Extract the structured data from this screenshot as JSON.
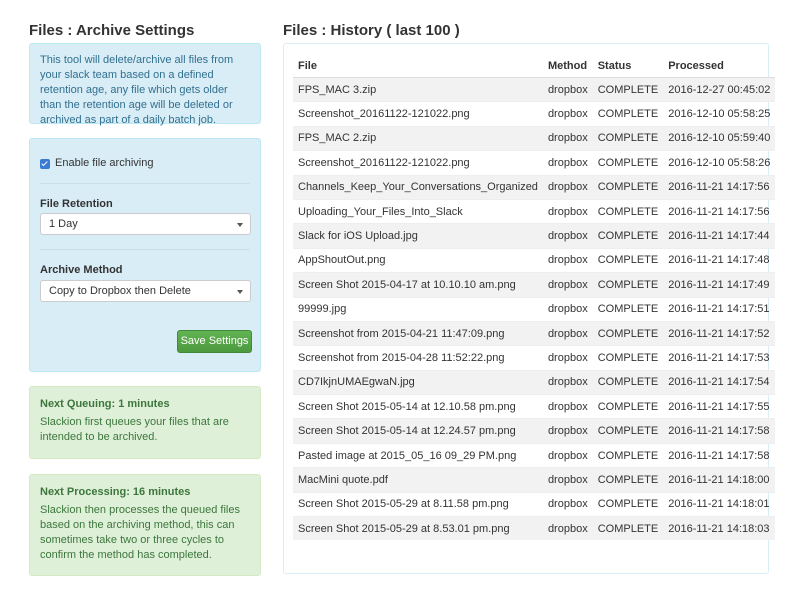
{
  "left_title": "Files : Archive Settings",
  "right_title": "Files : History ( last 100 )",
  "about_text": "This tool will delete/archive all files from your slack team based on a defined retention age, any file which gets older than the retention age will be deleted or archived as part of a daily batch job.",
  "settings": {
    "enable_label": "Enable file archiving",
    "enable_checked": true,
    "retention_label": "File Retention",
    "retention_value": "1 Day",
    "method_label": "Archive Method",
    "method_value": "Copy to Dropbox then Delete",
    "save_label": "Save Settings"
  },
  "queuing": {
    "title": "Next Queuing: 1 minutes",
    "text": "Slackion first queues your files that are intended to be archived."
  },
  "processing": {
    "title": "Next Processing: 16 minutes",
    "text": "Slackion then processes the queued files based on the archiving method, this can sometimes take two or three cycles to confirm the method has completed."
  },
  "history": {
    "columns": [
      "File",
      "Method",
      "Status",
      "Processed"
    ],
    "rows": [
      [
        "FPS_MAC 3.zip",
        "dropbox",
        "COMPLETE",
        "2016-12-27 00:45:02"
      ],
      [
        "Screenshot_20161122-121022.png",
        "dropbox",
        "COMPLETE",
        "2016-12-10 05:58:25"
      ],
      [
        "FPS_MAC 2.zip",
        "dropbox",
        "COMPLETE",
        "2016-12-10 05:59:40"
      ],
      [
        "Screenshot_20161122-121022.png",
        "dropbox",
        "COMPLETE",
        "2016-12-10 05:58:26"
      ],
      [
        "Channels_Keep_Your_Conversations_Organized",
        "dropbox",
        "COMPLETE",
        "2016-11-21 14:17:56"
      ],
      [
        "Uploading_Your_Files_Into_Slack",
        "dropbox",
        "COMPLETE",
        "2016-11-21 14:17:56"
      ],
      [
        "Slack for iOS Upload.jpg",
        "dropbox",
        "COMPLETE",
        "2016-11-21 14:17:44"
      ],
      [
        "AppShoutOut.png",
        "dropbox",
        "COMPLETE",
        "2016-11-21 14:17:48"
      ],
      [
        "Screen Shot 2015-04-17 at 10.10.10 am.png",
        "dropbox",
        "COMPLETE",
        "2016-11-21 14:17:49"
      ],
      [
        "99999.jpg",
        "dropbox",
        "COMPLETE",
        "2016-11-21 14:17:51"
      ],
      [
        "Screenshot from 2015-04-21 11:47:09.png",
        "dropbox",
        "COMPLETE",
        "2016-11-21 14:17:52"
      ],
      [
        "Screenshot from 2015-04-28 11:52:22.png",
        "dropbox",
        "COMPLETE",
        "2016-11-21 14:17:53"
      ],
      [
        "CD7IkjnUMAEgwaN.jpg",
        "dropbox",
        "COMPLETE",
        "2016-11-21 14:17:54"
      ],
      [
        "Screen Shot 2015-05-14 at 12.10.58 pm.png",
        "dropbox",
        "COMPLETE",
        "2016-11-21 14:17:55"
      ],
      [
        "Screen Shot 2015-05-14 at 12.24.57 pm.png",
        "dropbox",
        "COMPLETE",
        "2016-11-21 14:17:58"
      ],
      [
        "Pasted image at 2015_05_16 09_29 PM.png",
        "dropbox",
        "COMPLETE",
        "2016-11-21 14:17:58"
      ],
      [
        "MacMini quote.pdf",
        "dropbox",
        "COMPLETE",
        "2016-11-21 14:18:00"
      ],
      [
        "Screen Shot 2015-05-29 at 8.11.58 pm.png",
        "dropbox",
        "COMPLETE",
        "2016-11-21 14:18:01"
      ],
      [
        "Screen Shot 2015-05-29 at 8.53.01 pm.png",
        "dropbox",
        "COMPLETE",
        "2016-11-21 14:18:03"
      ]
    ]
  },
  "colors": {
    "info_bg": "#d9edf7",
    "success_bg": "#dff0d8",
    "save_button": "#5cab4c",
    "checkbox": "#3a7bd5"
  }
}
